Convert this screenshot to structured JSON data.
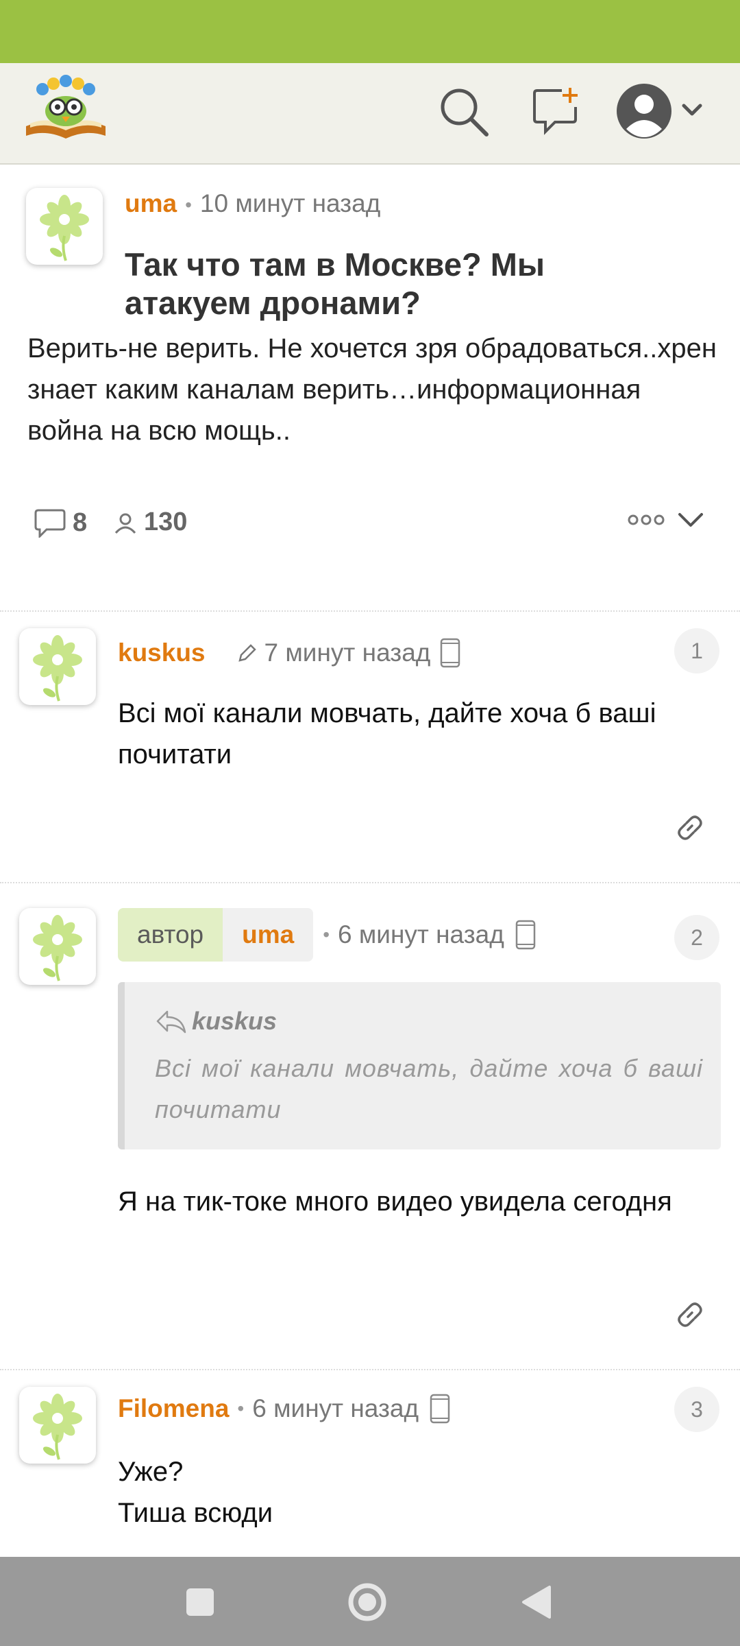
{
  "colors": {
    "status_bar": "#9bc143",
    "header_bg": "#f1f1ea",
    "accent": "#e07a10",
    "nav_bar": "#9a9a9a"
  },
  "header": {
    "logo": "book-owl-logo",
    "icons": [
      "search-icon",
      "new-post-icon",
      "user-avatar-icon",
      "chevron-down-icon"
    ]
  },
  "post": {
    "author": "uma",
    "time": "10 минут назад",
    "title": "Так что там в Москве? Мы атакуем дронами?",
    "body": "Верить-не верить. Не хочется зря обрадоваться..хрен знает каким каналам верить…информационная война на всю мощь..",
    "comments_count": "8",
    "views_count": "130"
  },
  "comments": [
    {
      "author": "kuskus",
      "time": "7 минут назад",
      "number": "1",
      "text": "Всі мої канали мовчать, дайте хоча б ваші почитати"
    },
    {
      "author_badge": "автор",
      "author": "uma",
      "time": "6 минут назад",
      "number": "2",
      "quote_author": "kuskus",
      "quote_text": "Всі мої канали мовчать, дайте хоча б ваші почитати",
      "text": "Я на тик-токе много видео увидела сегодня"
    },
    {
      "author": "Filomena",
      "time": "6 минут назад",
      "number": "3",
      "text_line1": "Уже?",
      "text_line2": "Тиша всюди"
    }
  ]
}
